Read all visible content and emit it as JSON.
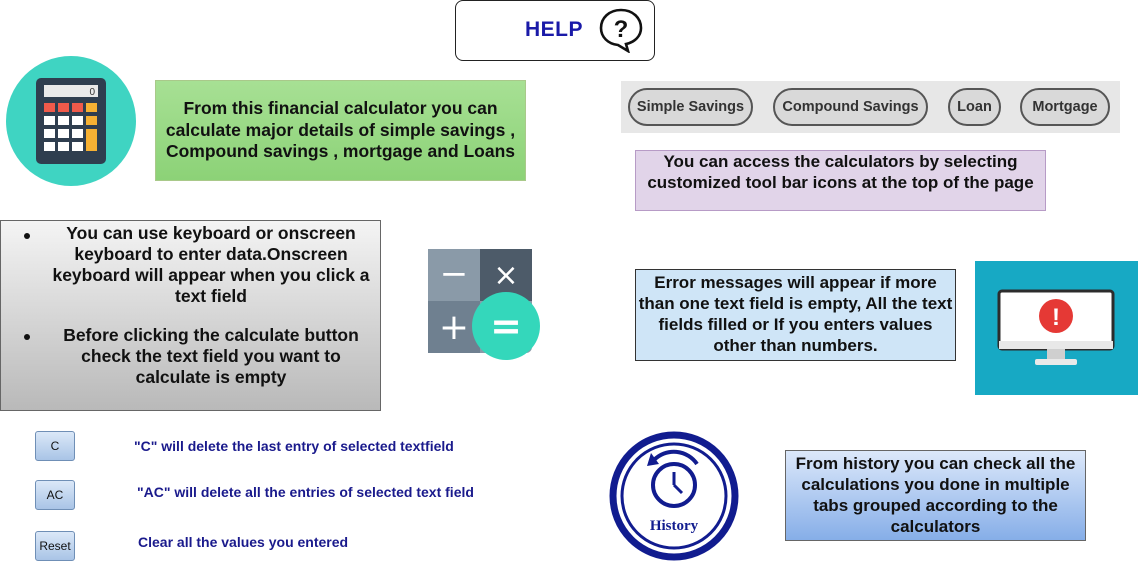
{
  "header": {
    "title": "HELP",
    "icon": "question-bubble-icon"
  },
  "intro": {
    "icon": "calculator-icon",
    "calc_display": "0",
    "text": "From this financial calculator you can calculate major details of simple savings , Compound savings , mortgage and Loans"
  },
  "toolbar": {
    "items": [
      {
        "label": "Simple Savings"
      },
      {
        "label": "Compound Savings"
      },
      {
        "label": "Loan"
      },
      {
        "label": "Mortgage"
      }
    ]
  },
  "access_text": "You can access the calculators by selecting customized tool bar icons at the top of the page",
  "keyboard": {
    "bullets": [
      "You can use keyboard or onscreen keyboard to enter data.Onscreen keyboard will appear when you click a text field",
      "Before clicking the calculate button check the text field you want to calculate is empty"
    ]
  },
  "ops_icon": {
    "name": "math-operations-icon",
    "minus": "−",
    "times": "×",
    "plus": "+",
    "equals": "="
  },
  "error": {
    "text": "Error messages will appear if more than one text field is empty, All the text fields filled or If you enters values other than numbers.",
    "icon": "monitor-alert-icon",
    "mark": "!"
  },
  "buttons": [
    {
      "label": "C",
      "desc": "\"C\" will delete the last entry of selected textfield"
    },
    {
      "label": "AC",
      "desc": "\"AC\" will delete all the entries of selected text field"
    },
    {
      "label": "Reset",
      "desc": "Clear all the values you entered"
    }
  ],
  "history": {
    "icon_label": "History",
    "text": "From history you can check all the calculations you done in multiple tabs grouped according to the calculators"
  },
  "colors": {
    "accent_blue": "#1a1aa8",
    "intro_green": "#a7e094",
    "access_purple": "#e1d4e9",
    "error_blue": "#cfe5f7",
    "monitor_teal": "#17a9c4",
    "alert_red": "#e53935"
  }
}
